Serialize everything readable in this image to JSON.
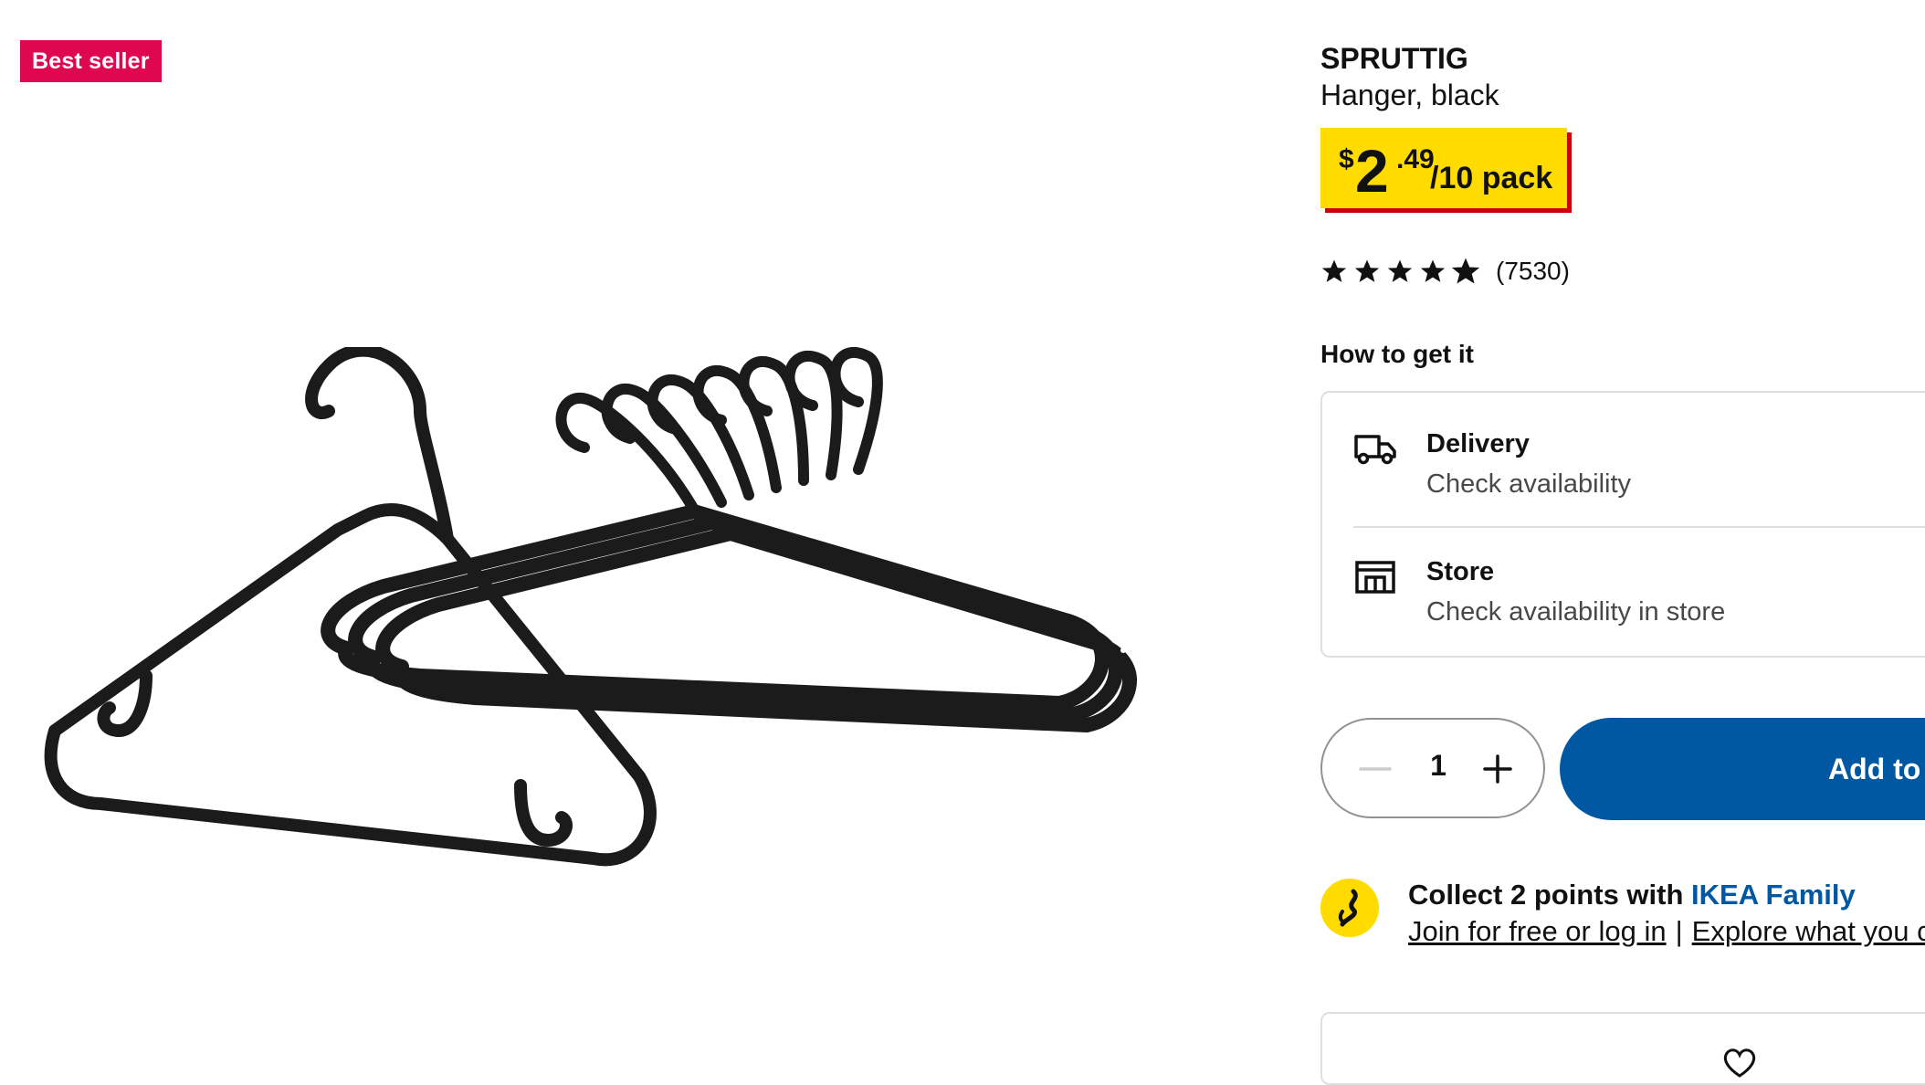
{
  "badge": {
    "label": "Best seller",
    "color": "#e00751"
  },
  "product": {
    "name": "SPRUTTIG",
    "description": "Hanger, black"
  },
  "price": {
    "currency": "$",
    "integer": "2",
    "decimal": ".49",
    "unit": "/10 pack"
  },
  "rating": {
    "stars": 4.7,
    "max": 5,
    "count": "(7530)"
  },
  "availability": {
    "heading": "How to get it",
    "delivery": {
      "icon": "truck-icon",
      "title": "Delivery",
      "subtitle": "Check availability"
    },
    "store": {
      "icon": "store-icon",
      "title": "Store",
      "subtitle": "Check availability in store"
    }
  },
  "quantity": {
    "value": "1"
  },
  "add_button": {
    "label": "Add to b"
  },
  "family": {
    "collect_prefix": "Collect 2 points with ",
    "collect_link": "IKEA Family",
    "join_link": "Join for free or log in",
    "separator": "|",
    "explore_link": "Explore what you ca"
  },
  "colors": {
    "accent_blue": "#0058a3",
    "price_yellow": "#ffdb00",
    "price_shadow": "#cc0008"
  }
}
